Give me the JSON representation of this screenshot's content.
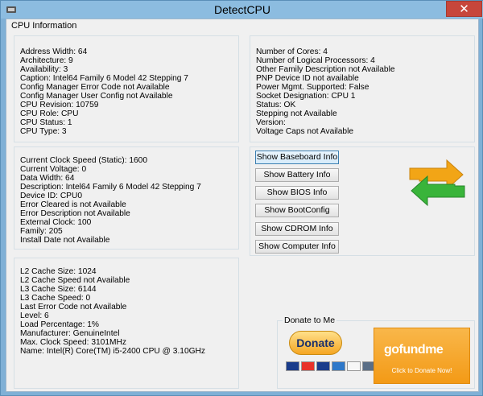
{
  "window": {
    "title": "DetectCPU",
    "close_glyph": "✕"
  },
  "group": {
    "label": "CPU Information"
  },
  "panel1": {
    "lines": [
      "Address Width: 64",
      "Architecture: 9",
      "Availability: 3",
      "Caption: Intel64 Family 6 Model 42 Stepping 7",
      "Config Manager Error Code not Available",
      "Config Manager User Config not Available",
      "CPU Revision: 10759",
      "CPU Role: CPU",
      "CPU Status: 1",
      "CPU Type: 3"
    ]
  },
  "panel2": {
    "lines": [
      "Number of Cores: 4",
      "Number of Logical Processors: 4",
      "Other Family Description not Available",
      "PNP Device ID not available",
      "Power Mgmt. Supported: False",
      "Socket Designation: CPU 1",
      "Status: OK",
      "Stepping not Available",
      "Version:",
      "Voltage Caps not Available"
    ]
  },
  "panel3": {
    "lines": [
      "Current Clock Speed (Static): 1600",
      "Current Voltage: 0",
      "Data Width: 64",
      "Description: Intel64 Family 6 Model 42 Stepping 7",
      "Device ID: CPU0",
      "Error Cleared is not Available",
      "Error Description not Available",
      "External Clock: 100",
      "Family: 205",
      "Install Date not Available"
    ]
  },
  "buttons": [
    "Show Baseboard Info",
    "Show Battery Info",
    "Show BIOS Info",
    "Show BootConfig",
    "Show CDROM Info",
    "Show Computer Info"
  ],
  "panel5": {
    "lines": [
      "L2 Cache Size: 1024",
      "L2 Cache Speed not Available",
      "L3 Cache Size: 6144",
      "L3 Cache Speed: 0",
      "Last Error Code not Available",
      "Level: 6",
      "Load Percentage: 1%",
      "Manufacturer: GenuineIntel",
      "Max. Clock Speed: 3101MHz",
      "Name: Intel(R) Core(TM) i5-2400 CPU @ 3.10GHz"
    ]
  },
  "donate": {
    "legend": "Donate to Me",
    "paypal_label": "Donate",
    "gofundme_logo": "gofundme",
    "gofundme_sub": "Click to Donate Now!"
  },
  "icons": {
    "app": "app-icon",
    "refresh": "refresh-arrows-icon"
  }
}
